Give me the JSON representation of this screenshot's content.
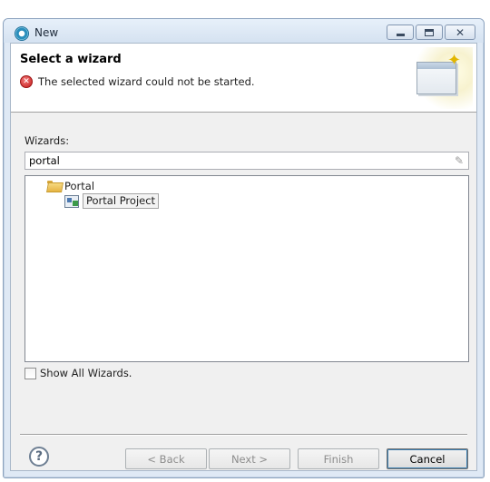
{
  "window": {
    "title": "New",
    "minimize_glyph": "",
    "maximize_glyph": "",
    "close_glyph": "✕"
  },
  "header": {
    "title": "Select a wizard",
    "error_message": "The selected wizard could not be started.",
    "error_icon": "error-icon",
    "banner_icon": "new-wizard-banner-icon"
  },
  "filter": {
    "label": "Wizards:",
    "value": "portal",
    "clear_icon": "eraser-icon"
  },
  "tree": {
    "items": [
      {
        "label": "Portal",
        "icon": "folder-open-icon",
        "level": 0
      },
      {
        "label": "Portal Project",
        "icon": "portal-project-icon",
        "level": 1,
        "selected": true
      }
    ]
  },
  "show_all": {
    "label": "Show All Wizards.",
    "checked": false
  },
  "footer": {
    "help_icon": "?",
    "back_label": "< Back",
    "next_label": "Next >",
    "finish_label": "Finish",
    "cancel_label": "Cancel"
  },
  "colors": {
    "frame": "#dfe9f5",
    "client": "#f0f0f0",
    "error_red": "#c41b1b",
    "focus_blue": "#3c7fb1"
  }
}
